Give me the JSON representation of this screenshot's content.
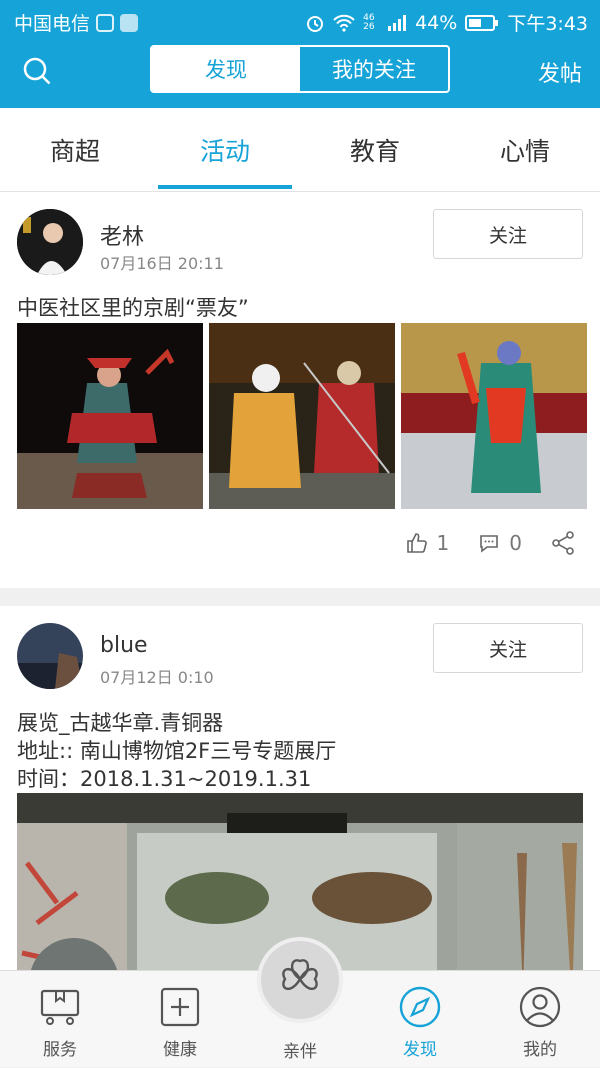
{
  "status": {
    "carrier": "中国电信",
    "signal_labels": "46 26",
    "battery": "44%",
    "time": "下午3:43"
  },
  "appbar": {
    "seg_discover": "发现",
    "seg_following": "我的关注",
    "post": "发帖"
  },
  "tabs": [
    "商超",
    "活动",
    "教育",
    "心情"
  ],
  "posts": [
    {
      "user": "老林",
      "time": "07月16日 20:11",
      "follow": "关注",
      "title": "中医社区里的京剧“票友”",
      "likes": "1",
      "comments": "0"
    },
    {
      "user": "blue",
      "time": "07月12日 0:10",
      "follow": "关注",
      "lines": [
        "展览_古越华章.青铜器",
        "地址:: 南山博物馆2F三号专题展厅",
        "时间：2018.1.31~2019.1.31"
      ]
    }
  ],
  "nav": {
    "service": "服务",
    "health": "健康",
    "companion": "亲伴",
    "discover": "发现",
    "mine": "我的"
  },
  "colors": {
    "accent": "#16a3d7"
  }
}
